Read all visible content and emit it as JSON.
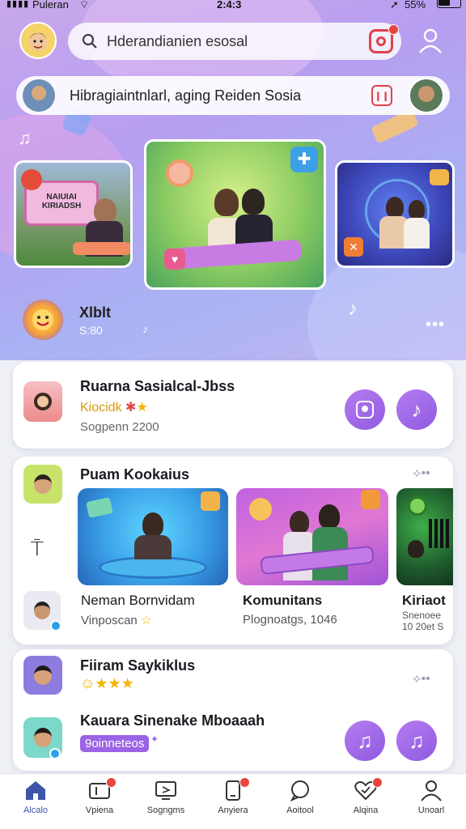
{
  "status": {
    "carrier": "Puleran",
    "time": "2:4:3",
    "battery": "55%"
  },
  "search": {
    "text": "Hderandianien esosal"
  },
  "top_user": {
    "text": "Hibragiaintnlarl, aging Reiden Sosia"
  },
  "featured": {
    "title": "Xlblt",
    "subtitle": "S:80",
    "banner_line1": "NAIUIAI",
    "banner_line2": "KIRIADSH"
  },
  "card1": {
    "title": "Ruarna Sasialcal-Jbss",
    "tag": "Kiocidk",
    "meta": "Sogpenn  2200"
  },
  "card2": {
    "title": "Puam Kookaius",
    "items": [
      {
        "title": "Neman Bornvidam",
        "meta": "Vinposcan"
      },
      {
        "title": "Komunitans",
        "meta": "Plognoatgs, 1046"
      },
      {
        "title": "Kiriaot",
        "meta": "Snenoee",
        "meta2": "10 20et S"
      }
    ]
  },
  "card3": {
    "title": "Fiiram Saykiklus",
    "subtitle": "Kauara Sinenake Mboaaah",
    "chip": "9oinneteos"
  },
  "tabs": [
    "Alcalo",
    "Vpiena",
    "Sogngms",
    "Anyiera",
    "Aoitool",
    "Alqina",
    "Unoarl"
  ],
  "colors": {
    "accent": "#9b63e6",
    "active_tab": "#3d55a8",
    "badge": "#e8453c"
  },
  "icons": [
    "search-icon",
    "camera-icon",
    "profile-icon",
    "record-icon",
    "more-icon",
    "chat-icon",
    "music-note-icon",
    "home-icon",
    "video-icon",
    "screen-icon",
    "phone-icon",
    "message-icon",
    "heart-icon",
    "user-icon"
  ]
}
